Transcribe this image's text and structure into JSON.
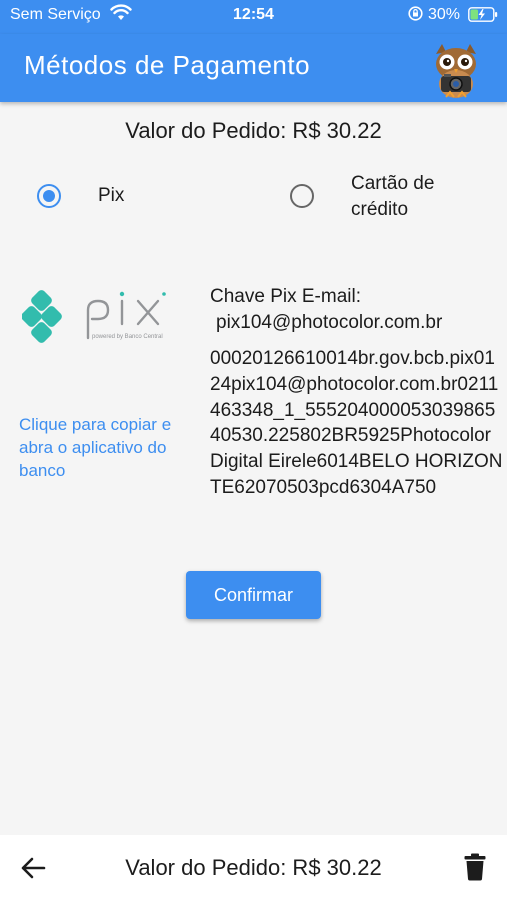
{
  "status_bar": {
    "carrier": "Sem Serviço",
    "time": "12:54",
    "battery": "30%"
  },
  "app_bar": {
    "title": "Métodos de Pagamento",
    "avatar_icon": "owl-camera-mascot"
  },
  "order": {
    "label": "Valor do Pedido: R$ 30.22"
  },
  "payment_options": [
    {
      "label": "Pix",
      "selected": true
    },
    {
      "label": "Cartão de crédito",
      "selected": false
    }
  ],
  "pix": {
    "logo_text": "pix",
    "logo_subtext": "powered by Banco Central",
    "copy_hint": "Clique para copiar e abra o aplicativo do banco",
    "key_title": "Chave Pix E-mail:",
    "key_email": "pix104@photocolor.com.br",
    "code": "00020126610014br.gov.bcb.pix0124pix104@photocolor.com.br0211463348_1_55520400005303986540530.225802BR5925Photocolor Digital Eirele6014BELO HORIZONTE62070503pcd6304A750"
  },
  "confirm_button": "Confirmar",
  "bottom_bar": {
    "total": "Valor do Pedido: R$ 30.22",
    "back_icon": "arrow-left-icon",
    "delete_icon": "trash-icon"
  },
  "colors": {
    "primary": "#3d8ef0",
    "pix_teal": "#32bcad",
    "background": "#f5f5f5"
  }
}
